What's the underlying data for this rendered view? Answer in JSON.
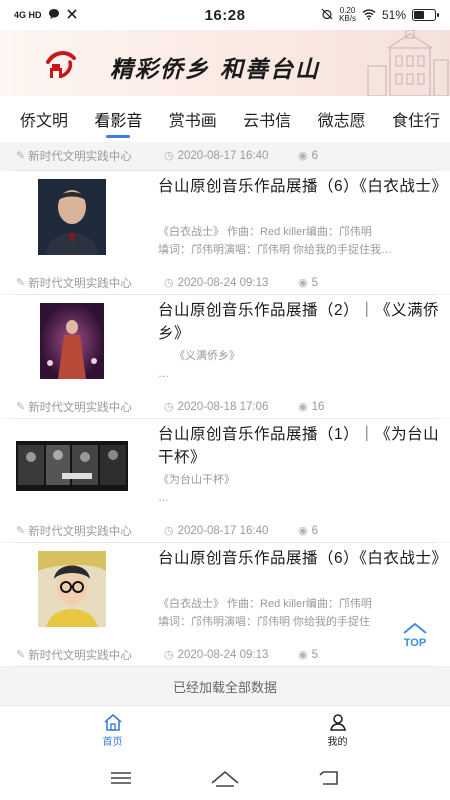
{
  "status_bar": {
    "signal": "4G HD",
    "time": "16:28",
    "net_speed_value": "0.20",
    "net_speed_unit": "KB/s",
    "battery": "51%",
    "battery_level": 0.51
  },
  "banner": {
    "title": "精彩侨乡  和善台山"
  },
  "tabs": [
    {
      "label": "侨文明",
      "active": false
    },
    {
      "label": "看影音",
      "active": true
    },
    {
      "label": "赏书画",
      "active": false
    },
    {
      "label": "云书信",
      "active": false
    },
    {
      "label": "微志愿",
      "active": false
    },
    {
      "label": "食住行",
      "active": false
    }
  ],
  "top_meta": {
    "source": "新时代文明实践中心",
    "time": "2020-08-17 16:40",
    "views": "6"
  },
  "items": [
    {
      "title": "台山原创音乐作品展播（6）《白衣战士》",
      "desc_line1": "《白衣战士》 作曲：Red killer编曲：邝伟明",
      "desc_line2": "填词：邝伟明演唱：邝伟明 你给我的手捉住我…",
      "source": "新时代文明实践中心",
      "time": "2020-08-24 09:13",
      "views": "5"
    },
    {
      "title": "台山原创音乐作品展播（2）｜《义满侨乡》",
      "desc_line1": "《义满侨乡》",
      "desc_line2": "…",
      "source": "新时代文明实践中心",
      "time": "2020-08-18 17:06",
      "views": "16"
    },
    {
      "title": "台山原创音乐作品展播（1）｜《为台山干杯》",
      "desc_line1": "《为台山干杯》",
      "desc_line2": "…",
      "source": "新时代文明实践中心",
      "time": "2020-08-17 16:40",
      "views": "6"
    },
    {
      "title": "台山原创音乐作品展播（6）《白衣战士》",
      "desc_line1": "《白衣战士》 作曲：Red killer编曲：邝伟明",
      "desc_line2": "填词：邝伟明演唱：邝伟明 你给我的手捉住",
      "source": "新时代文明实践中心",
      "time": "2020-08-24 09:13",
      "views": "5"
    }
  ],
  "loaded_text": "已经加载全部数据",
  "top_button": "TOP",
  "bottom_nav": [
    {
      "label": "首页",
      "active": true
    },
    {
      "label": "我的",
      "active": false
    }
  ],
  "colors": {
    "accent": "#3a7be0",
    "logo_red": "#c8161d",
    "meta_gray": "#9a9a9a"
  },
  "icons": [
    "pencil-icon",
    "clock-icon",
    "eye-icon",
    "home-icon",
    "user-icon",
    "menu-icon",
    "home-outline-icon",
    "back-icon"
  ]
}
